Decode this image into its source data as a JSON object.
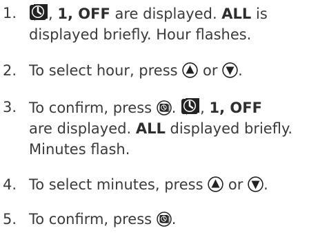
{
  "steps": [
    {
      "number": "1.",
      "segments": [
        {
          "icon": "timer-clock-icon"
        },
        {
          "text": ", "
        },
        {
          "bold": "1, OFF"
        },
        {
          "text": " are displayed. "
        },
        {
          "bold": "ALL"
        },
        {
          "text": " is"
        }
      ],
      "lines": [
        "displayed briefly. Hour flashes."
      ]
    },
    {
      "number": "2.",
      "line": [
        "To select hour, press ",
        "or",
        "."
      ]
    },
    {
      "number": "3.",
      "line1": [
        "To confirm, press ",
        ". ",
        ", ",
        "1, OFF"
      ],
      "line2": [
        "are displayed. ",
        "ALL",
        " displayed briefly."
      ],
      "line3": "Minutes flash."
    },
    {
      "number": "4.",
      "line": [
        "To select minutes, press ",
        "or",
        "."
      ]
    },
    {
      "number": "5.",
      "line": [
        "To confirm, press ",
        "."
      ]
    }
  ],
  "icons": {
    "timer": "timer-clock-icon",
    "up": "up-arrow-button-icon",
    "down": "down-arrow-button-icon",
    "confirm": "timer-button-icon"
  },
  "colors": {
    "text": "#3a3a3a",
    "icon": "#222222"
  }
}
